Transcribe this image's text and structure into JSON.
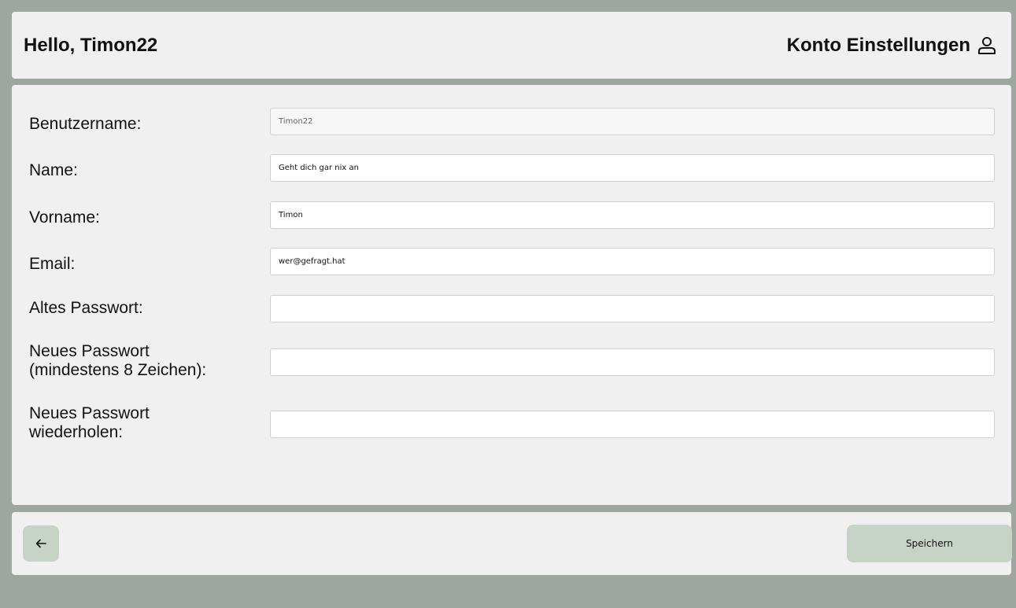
{
  "header": {
    "greeting": "Hello, Timon22",
    "account_link_label": "Konto Einstellungen",
    "account_icon": "user-icon"
  },
  "form": {
    "username": {
      "label": "Benutzername:",
      "value": "Timon22",
      "readonly": true
    },
    "lastname": {
      "label": "Name:",
      "value": "Geht dich gar nix an"
    },
    "firstname": {
      "label": "Vorname:",
      "value": "Timon"
    },
    "email": {
      "label": "Email:",
      "value": "wer@gefragt.hat"
    },
    "old_password": {
      "label": "Altes Passwort:",
      "value": ""
    },
    "new_password": {
      "label_line1": "Neues Passwort",
      "label_line2": "(mindestens 8 Zeichen):",
      "value": ""
    },
    "repeat_password": {
      "label_line1": "Neues Passwort",
      "label_line2": "wiederholen:",
      "value": ""
    }
  },
  "footer": {
    "back_icon": "arrow-left-icon",
    "save_label": "Speichern"
  },
  "colors": {
    "background": "#9ea69f",
    "panel": "#f0f0f0",
    "button": "#c6d3c6"
  }
}
